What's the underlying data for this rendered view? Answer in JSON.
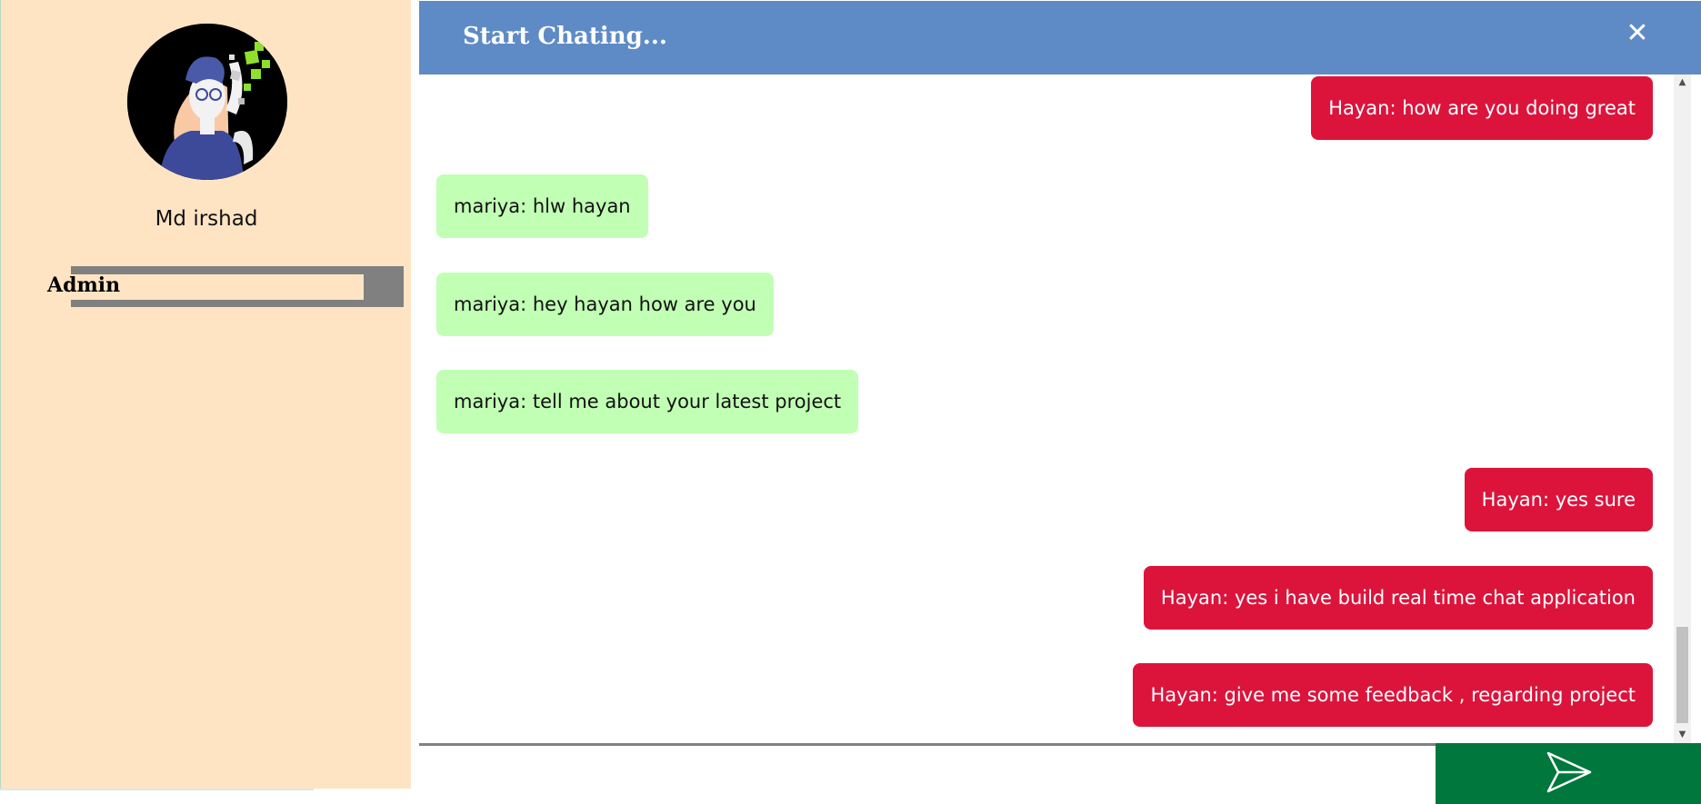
{
  "sidebar": {
    "profile_name": "Md irshad",
    "role_label": "Admin",
    "avatar_icon": "user-avatar-icon"
  },
  "chat": {
    "title": "Start Chating...",
    "close_label": "✕",
    "messages": [
      {
        "from": "sent",
        "text": "Hayan: how are you doing great"
      },
      {
        "from": "recv",
        "text": "mariya: hlw hayan"
      },
      {
        "from": "recv",
        "text": "mariya: hey hayan how are you"
      },
      {
        "from": "recv",
        "text": "mariya: tell me about your latest project"
      },
      {
        "from": "sent",
        "text": "Hayan: yes sure"
      },
      {
        "from": "sent",
        "text": "Hayan: yes i have build real time chat application"
      },
      {
        "from": "sent",
        "text": "Hayan: give me some feedback , regarding project"
      }
    ]
  },
  "composer": {
    "input_value": "",
    "send_icon": "send-icon"
  },
  "colors": {
    "sidebar_bg": "#ffe4c4",
    "header_bg": "#5e8bc5",
    "sent_bubble": "#dc143c",
    "recv_bubble": "#c1ffb4",
    "send_button": "#00773c",
    "admin_bar": "#808080"
  }
}
